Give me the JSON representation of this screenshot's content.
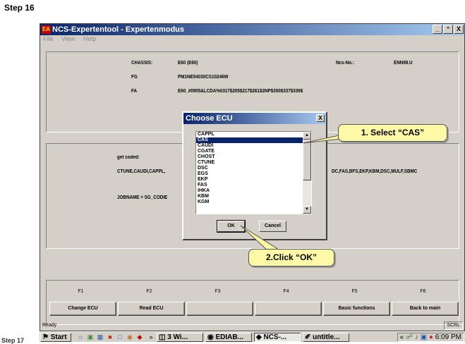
{
  "page": {
    "step_title": "Step 16",
    "step_cut_text": "Step 17"
  },
  "window": {
    "title": "NCS-Expertentool - Expertenmodus",
    "icon_text": "EA",
    "menu": [
      "File",
      "View",
      "Help"
    ],
    "minimize": "_",
    "restore": "°",
    "close": "X"
  },
  "info": {
    "chassis_label": "CHASSIS:",
    "chassis_value": "E60 (E60)",
    "ncsnr_label": "Ncs-No.:",
    "ncsnr_value": "ENN98.U",
    "fg_label": "FG",
    "fg_value": "PM1NE54030CS10246W",
    "fa_label": "FA",
    "fa_value": "E60_#0905&LCDA%0317$205$217$261$2NP$300$337$339$"
  },
  "coding": {
    "get_coded_label": "get coded:",
    "ecu_list_left": "CTUNE,CAUDI,CAPPL,",
    "ecu_list_right": "DC,FAS,BFS,EKP,KBM,DSC,MULF,SBMC",
    "jobname": "JOBNAME = SG_CODIE"
  },
  "dialog": {
    "title": "Choose ECU",
    "close": "X",
    "items": [
      "CAPPL",
      "CAS",
      "CAUDI",
      "CGATE",
      "CHOST",
      "CTUNE",
      "DSC",
      "EGS",
      "EKP",
      "FAS",
      "IHKA",
      "KBM",
      "KGM"
    ],
    "selected": "CAS",
    "ok_label": "OK",
    "cancel_label": "Cancel",
    "scroll_up": "▲",
    "scroll_down": "▼"
  },
  "callouts": {
    "select": "1. Select “CAS”",
    "click": "2.Click “OK”"
  },
  "fkeys": [
    {
      "key": "F1",
      "label": "Change ECU"
    },
    {
      "key": "F2",
      "label": "Read ECU"
    },
    {
      "key": "F3",
      "label": ""
    },
    {
      "key": "F4",
      "label": ""
    },
    {
      "key": "F5",
      "label": "Basic functions"
    },
    {
      "key": "F6",
      "label": "Back to main"
    }
  ],
  "status": {
    "text": "Ready",
    "scrl": "SCRL"
  },
  "taskbar": {
    "start": "Start",
    "chevron": "»",
    "items": [
      "3 Wi...",
      "EDIAB...",
      "NCS-...",
      "untitle..."
    ],
    "active": "NCS-...",
    "tray_chevron": "«",
    "clock": "6:09 PM"
  },
  "colors": {
    "titlebar": "#0a246a",
    "selection": "#0a246a",
    "callout": "#fff9a8"
  }
}
